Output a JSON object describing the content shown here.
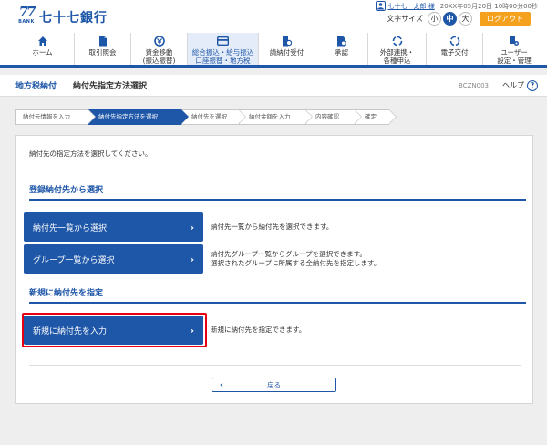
{
  "brand": {
    "mark": "77",
    "bank": "BANK",
    "name": "七十七銀行"
  },
  "user": {
    "name": "七十七　太郎 様",
    "datetime": "20XX年05月20日 10時00分00秒"
  },
  "fontsize": {
    "label": "文字サイズ",
    "small": "小",
    "medium": "中",
    "large": "大"
  },
  "logout_label": "ログアウト",
  "nav": [
    {
      "label": "ホーム",
      "icon": "home-icon"
    },
    {
      "label": "取引照会",
      "icon": "document-icon"
    },
    {
      "label": "資金移動\n(振込振替)",
      "icon": "transfer-icon"
    },
    {
      "label": "総合振込・給与振込\n口座振替・地方税",
      "icon": "payment-icon"
    },
    {
      "label": "請納付受付",
      "icon": "tax-icon"
    },
    {
      "label": "承認",
      "icon": "approve-icon"
    },
    {
      "label": "外部連携・\n各種申込",
      "icon": "link-icon"
    },
    {
      "label": "電子交付",
      "icon": "ebook-icon"
    },
    {
      "label": "ユーザー\n設定・管理",
      "icon": "user-settings-icon"
    }
  ],
  "page": {
    "category": "地方税納付",
    "title": "納付先指定方法選択",
    "code": "BCZN003",
    "help": "ヘルプ",
    "help_icon": "?"
  },
  "steps": [
    "納付元情報を入力",
    "納付先指定方法を選択",
    "納付先を選択",
    "納付金額を入力",
    "内容確認",
    "確定"
  ],
  "intro": "納付先の指定方法を選択してください。",
  "sections": {
    "registered": {
      "heading": "登録納付先から選択",
      "list_button": "納付先一覧から選択",
      "list_desc": "納付先一覧から納付先を選択できます。",
      "group_button": "グループ一覧から選択",
      "group_desc_1": "納付先グループ一覧からグループを選択できます。",
      "group_desc_2": "選択されたグループに所属する全納付先を指定します。"
    },
    "new": {
      "heading": "新規に納付先を指定",
      "new_button": "新規に納付先を入力",
      "new_desc": "新規に納付先を指定できます。"
    }
  },
  "back_label": "戻る",
  "chevron_right": "›",
  "chevron_left": "‹",
  "colors": {
    "primary": "#1e56a8",
    "accent": "#f4a21e",
    "highlight": "#e60012"
  }
}
